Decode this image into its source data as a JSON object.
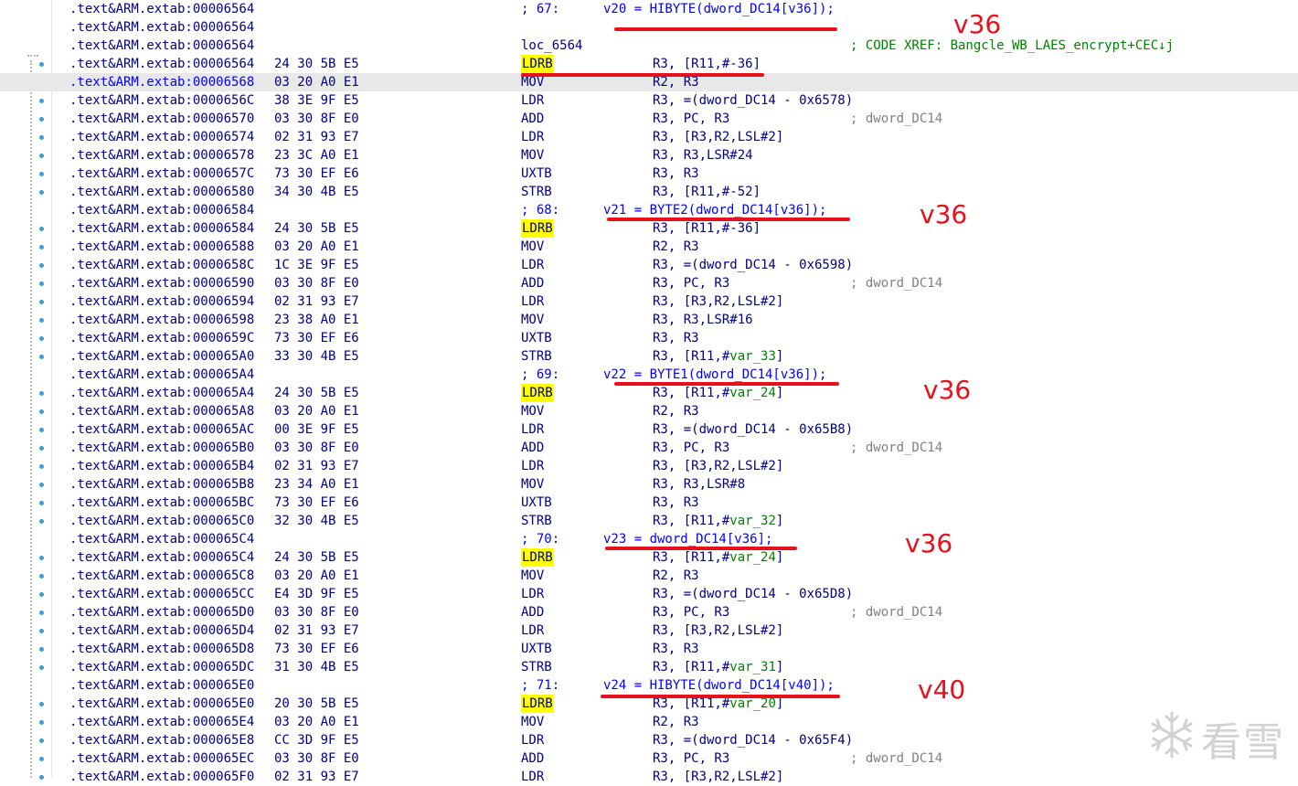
{
  "listing": [
    {
      "addr": ".text&ARM.extab:00006564",
      "sub": "; 67:",
      "pseudo": "v20 = HIBYTE(dword_DC14[v36]);"
    },
    {
      "addr": ".text&ARM.extab:00006564"
    },
    {
      "addr": ".text&ARM.extab:00006564",
      "label": "loc_6564",
      "xref": "; CODE XREF: Bangcle_WB_LAES_encrypt+CEC↓j"
    },
    {
      "addr": ".text&ARM.extab:00006564",
      "bytes": "24 30 5B E5",
      "mnem": "LDRB",
      "hl": true,
      "ops": "R3, [R11,#-36]"
    },
    {
      "addr": ".text&ARM.extab:00006568",
      "bytes": "03 20 A0 E1",
      "mnem": "MOV",
      "ops": "R2, R3",
      "sel": true
    },
    {
      "addr": ".text&ARM.extab:0000656C",
      "bytes": "38 3E 9F E5",
      "mnem": "LDR",
      "ops": "R3, =(dword_DC14 - 0x6578)"
    },
    {
      "addr": ".text&ARM.extab:00006570",
      "bytes": "03 30 8F E0",
      "mnem": "ADD",
      "ops": "R3, PC, R3",
      "cmt": "; dword_DC14"
    },
    {
      "addr": ".text&ARM.extab:00006574",
      "bytes": "02 31 93 E7",
      "mnem": "LDR",
      "ops": "R3, [R3,R2,LSL#2]"
    },
    {
      "addr": ".text&ARM.extab:00006578",
      "bytes": "23 3C A0 E1",
      "mnem": "MOV",
      "ops": "R3, R3,LSR#24"
    },
    {
      "addr": ".text&ARM.extab:0000657C",
      "bytes": "73 30 EF E6",
      "mnem": "UXTB",
      "ops": "R3, R3"
    },
    {
      "addr": ".text&ARM.extab:00006580",
      "bytes": "34 30 4B E5",
      "mnem": "STRB",
      "ops": "R3, [R11,#-52]"
    },
    {
      "addr": ".text&ARM.extab:00006584",
      "sub": "; 68:",
      "pseudo": "v21 = BYTE2(dword_DC14[v36]);"
    },
    {
      "addr": ".text&ARM.extab:00006584",
      "bytes": "24 30 5B E5",
      "mnem": "LDRB",
      "hl": true,
      "ops": "R3, [R11,#-36]"
    },
    {
      "addr": ".text&ARM.extab:00006588",
      "bytes": "03 20 A0 E1",
      "mnem": "MOV",
      "ops": "R2, R3"
    },
    {
      "addr": ".text&ARM.extab:0000658C",
      "bytes": "1C 3E 9F E5",
      "mnem": "LDR",
      "ops": "R3, =(dword_DC14 - 0x6598)"
    },
    {
      "addr": ".text&ARM.extab:00006590",
      "bytes": "03 30 8F E0",
      "mnem": "ADD",
      "ops": "R3, PC, R3",
      "cmt": "; dword_DC14"
    },
    {
      "addr": ".text&ARM.extab:00006594",
      "bytes": "02 31 93 E7",
      "mnem": "LDR",
      "ops": "R3, [R3,R2,LSL#2]"
    },
    {
      "addr": ".text&ARM.extab:00006598",
      "bytes": "23 38 A0 E1",
      "mnem": "MOV",
      "ops": "R3, R3,LSR#16"
    },
    {
      "addr": ".text&ARM.extab:0000659C",
      "bytes": "73 30 EF E6",
      "mnem": "UXTB",
      "ops": "R3, R3"
    },
    {
      "addr": ".text&ARM.extab:000065A0",
      "bytes": "33 30 4B E5",
      "mnem": "STRB",
      "ops": "R3, [R11,#",
      "var": "var_33",
      "ops_end": "]"
    },
    {
      "addr": ".text&ARM.extab:000065A4",
      "sub": "; 69:",
      "pseudo": "v22 = BYTE1(dword_DC14[v36]);"
    },
    {
      "addr": ".text&ARM.extab:000065A4",
      "bytes": "24 30 5B E5",
      "mnem": "LDRB",
      "hl": true,
      "ops": "R3, [R11,#",
      "var": "var_24",
      "ops_end": "]"
    },
    {
      "addr": ".text&ARM.extab:000065A8",
      "bytes": "03 20 A0 E1",
      "mnem": "MOV",
      "ops": "R2, R3"
    },
    {
      "addr": ".text&ARM.extab:000065AC",
      "bytes": "00 3E 9F E5",
      "mnem": "LDR",
      "ops": "R3, =(dword_DC14 - 0x65B8)"
    },
    {
      "addr": ".text&ARM.extab:000065B0",
      "bytes": "03 30 8F E0",
      "mnem": "ADD",
      "ops": "R3, PC, R3",
      "cmt": "; dword_DC14"
    },
    {
      "addr": ".text&ARM.extab:000065B4",
      "bytes": "02 31 93 E7",
      "mnem": "LDR",
      "ops": "R3, [R3,R2,LSL#2]"
    },
    {
      "addr": ".text&ARM.extab:000065B8",
      "bytes": "23 34 A0 E1",
      "mnem": "MOV",
      "ops": "R3, R3,LSR#8"
    },
    {
      "addr": ".text&ARM.extab:000065BC",
      "bytes": "73 30 EF E6",
      "mnem": "UXTB",
      "ops": "R3, R3"
    },
    {
      "addr": ".text&ARM.extab:000065C0",
      "bytes": "32 30 4B E5",
      "mnem": "STRB",
      "ops": "R3, [R11,#",
      "var": "var_32",
      "ops_end": "]"
    },
    {
      "addr": ".text&ARM.extab:000065C4",
      "sub": "; 70:",
      "pseudo": "v23 = dword_DC14[v36];"
    },
    {
      "addr": ".text&ARM.extab:000065C4",
      "bytes": "24 30 5B E5",
      "mnem": "LDRB",
      "hl": true,
      "ops": "R3, [R11,#",
      "var": "var_24",
      "ops_end": "]"
    },
    {
      "addr": ".text&ARM.extab:000065C8",
      "bytes": "03 20 A0 E1",
      "mnem": "MOV",
      "ops": "R2, R3"
    },
    {
      "addr": ".text&ARM.extab:000065CC",
      "bytes": "E4 3D 9F E5",
      "mnem": "LDR",
      "ops": "R3, =(dword_DC14 - 0x65D8)"
    },
    {
      "addr": ".text&ARM.extab:000065D0",
      "bytes": "03 30 8F E0",
      "mnem": "ADD",
      "ops": "R3, PC, R3",
      "cmt": "; dword_DC14"
    },
    {
      "addr": ".text&ARM.extab:000065D4",
      "bytes": "02 31 93 E7",
      "mnem": "LDR",
      "ops": "R3, [R3,R2,LSL#2]"
    },
    {
      "addr": ".text&ARM.extab:000065D8",
      "bytes": "73 30 EF E6",
      "mnem": "UXTB",
      "ops": "R3, R3"
    },
    {
      "addr": ".text&ARM.extab:000065DC",
      "bytes": "31 30 4B E5",
      "mnem": "STRB",
      "ops": "R3, [R11,#",
      "var": "var_31",
      "ops_end": "]"
    },
    {
      "addr": ".text&ARM.extab:000065E0",
      "sub": "; 71:",
      "pseudo": "v24 = HIBYTE(dword_DC14[v40]);"
    },
    {
      "addr": ".text&ARM.extab:000065E0",
      "bytes": "20 30 5B E5",
      "mnem": "LDRB",
      "hl": true,
      "ops": "R3, [R11,#",
      "var": "var_20",
      "ops_end": "]"
    },
    {
      "addr": ".text&ARM.extab:000065E4",
      "bytes": "03 20 A0 E1",
      "mnem": "MOV",
      "ops": "R2, R3"
    },
    {
      "addr": ".text&ARM.extab:000065E8",
      "bytes": "CC 3D 9F E5",
      "mnem": "LDR",
      "ops": "R3, =(dword_DC14 - 0x65F4)"
    },
    {
      "addr": ".text&ARM.extab:000065EC",
      "bytes": "03 30 8F E0",
      "mnem": "ADD",
      "ops": "R3, PC, R3",
      "cmt": "; dword_DC14"
    },
    {
      "addr": ".text&ARM.extab:000065F0",
      "bytes": "02 31 93 E7",
      "mnem": "LDR",
      "ops": "R3, [R3,R2,LSL#2]"
    }
  ],
  "annotations": [
    "v36",
    "v36",
    "v36",
    "v36",
    "v40"
  ],
  "colors": {
    "annotation": "#e8101c",
    "highlight": "#ffff00",
    "code": "#000080",
    "pseudo": "#0000ff",
    "comment": "#808080",
    "xref": "#008000"
  },
  "watermark": {
    "text": "看雪",
    "icon": "snowflake-icon"
  }
}
